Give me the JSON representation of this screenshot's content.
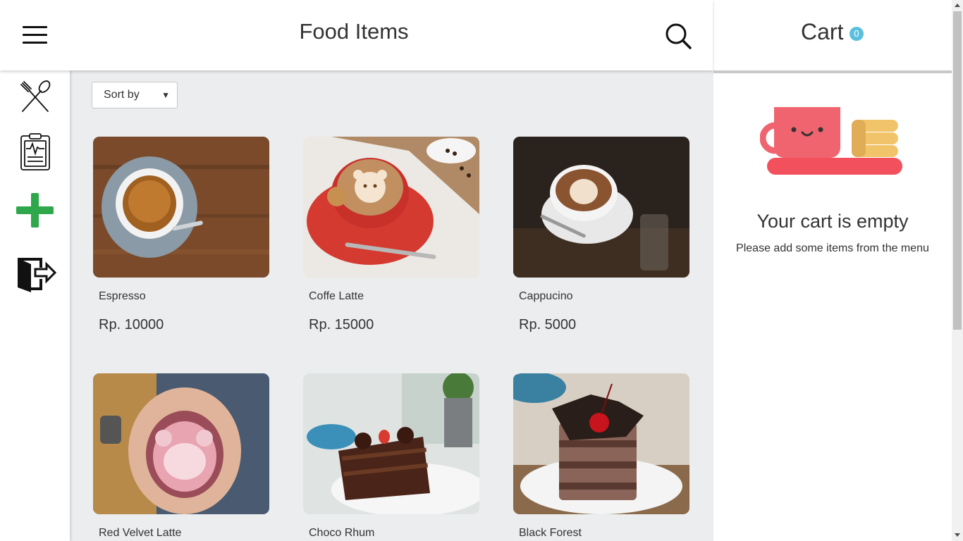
{
  "header": {
    "title": "Food Items",
    "menu_icon": "hamburger-menu-icon",
    "search_icon": "search-icon"
  },
  "sidebar": {
    "items": [
      {
        "icon": "fork-spoon-icon",
        "label": "Menu"
      },
      {
        "icon": "clipboard-report-icon",
        "label": "History"
      },
      {
        "icon": "plus-icon",
        "label": "Add"
      },
      {
        "icon": "logout-icon",
        "label": "Logout"
      }
    ]
  },
  "main": {
    "sort": {
      "selected": "Sort by"
    },
    "products": [
      {
        "name": "Espresso",
        "price": "Rp. 10000"
      },
      {
        "name": "Coffe Latte",
        "price": "Rp. 15000"
      },
      {
        "name": "Cappucino",
        "price": "Rp. 5000"
      },
      {
        "name": "Red Velvet Latte",
        "price": ""
      },
      {
        "name": "Choco Rhum",
        "price": ""
      },
      {
        "name": "Black Forest",
        "price": ""
      }
    ]
  },
  "cart": {
    "title": "Cart",
    "count": "0",
    "empty_title": "Your cart is empty",
    "empty_subtitle": "Please add some items from the menu"
  },
  "colors": {
    "main_bg": "#ebedef",
    "badge": "#5bc0de",
    "add_icon": "#2ea84a",
    "cup": "#f06470",
    "cookie": "#f2c46a"
  }
}
